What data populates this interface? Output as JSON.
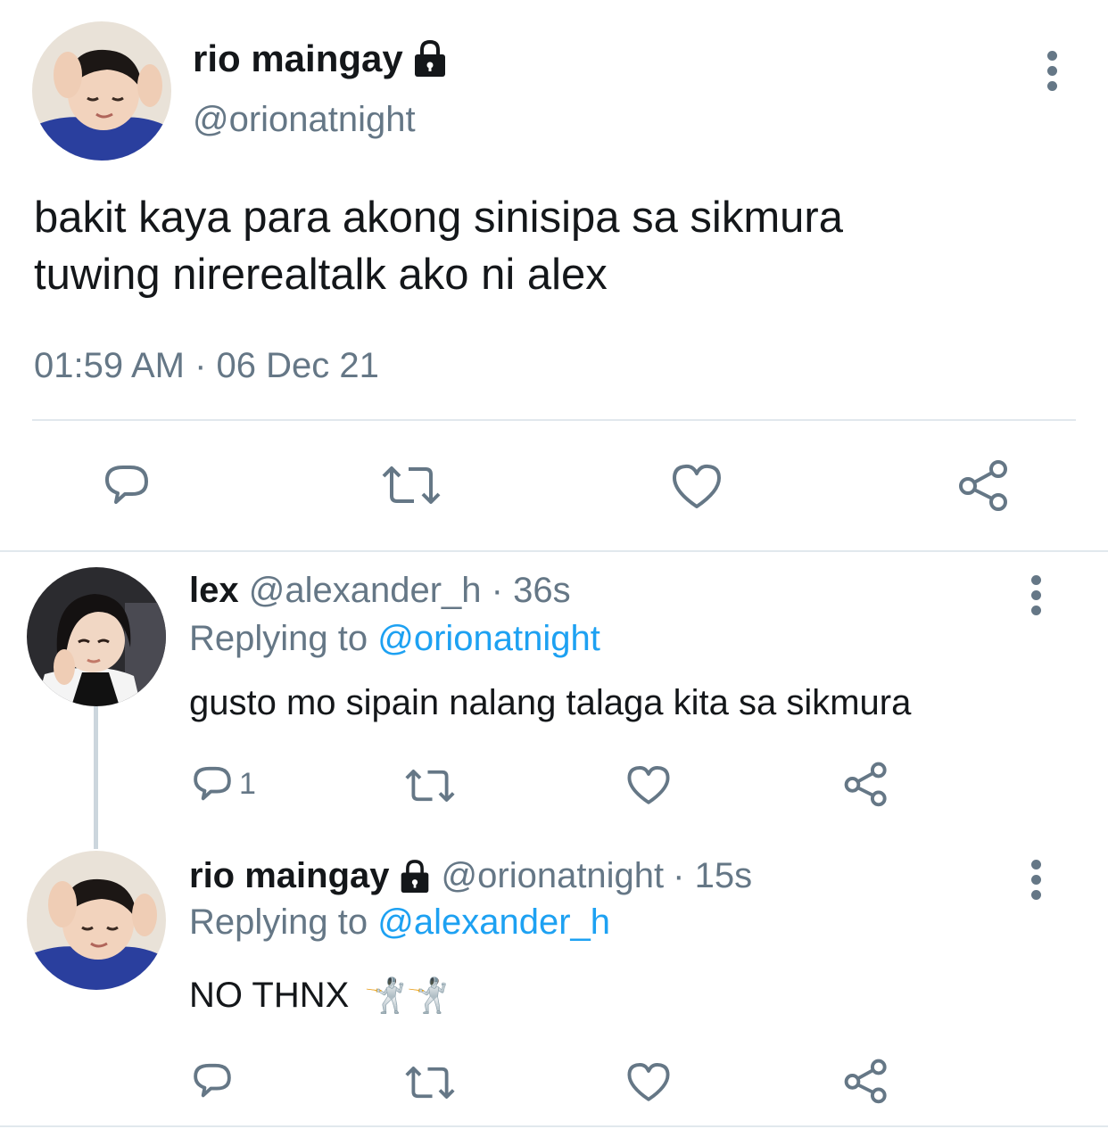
{
  "main_tweet": {
    "display_name": "rio maingay",
    "handle": "@orionatnight",
    "text_line1": "bakit kaya para akong sinisipa sa sikmura",
    "text_line2": "tuwing nirerealtalk ako ni alex",
    "timestamp": "01:59 AM · 06 Dec 21",
    "actions": [
      "reply-icon",
      "retweet-icon",
      "like-icon",
      "share-icon"
    ]
  },
  "replies": [
    {
      "display_name": "lex",
      "handle": "@alexander_h",
      "age": "· 36s",
      "replying_label": "Replying to",
      "replying_to": "@orionatnight",
      "text": "gusto mo sipain nalang talaga kita sa sikmura",
      "reply_count": "1"
    },
    {
      "display_name": "rio maingay",
      "handle": "@orionatnight",
      "age": "· 15s",
      "replying_label": "Replying to",
      "replying_to": "@alexander_h",
      "text": "NO THNX",
      "emoji": "🤺🤺",
      "reply_count": ""
    }
  ],
  "colors": {
    "text": "#14171a",
    "muted": "#657786",
    "link": "#1da1f2",
    "divider": "#e1e8ed"
  }
}
